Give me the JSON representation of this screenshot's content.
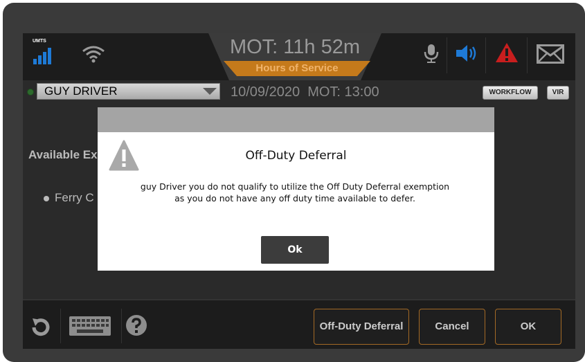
{
  "status_bar": {
    "network_label": "UMTS",
    "mot_timer": "MOT: 11h 52m",
    "hos_tab_label": "Hours of Service",
    "icons": [
      "signal-bars-icon",
      "wifi-icon",
      "microphone-icon",
      "speaker-icon",
      "warning-icon",
      "mail-icon"
    ],
    "colors": {
      "accent_orange": "#c57a1b",
      "speaker_blue": "#1e7ad6",
      "warning_red": "#c81e1e"
    }
  },
  "driver_row": {
    "driver_name": "GUY DRIVER",
    "date_mot": "10/09/2020  MOT: 13:00",
    "workflow_label": "WORKFLOW",
    "vir_label": "VIR"
  },
  "background_content": {
    "heading": "Available Ex",
    "list_item": "Ferry C"
  },
  "bottom_bar": {
    "icons": [
      "refresh-icon",
      "keyboard-icon",
      "help-icon"
    ],
    "off_duty_label": "Off-Duty Deferral",
    "cancel_label": "Cancel",
    "ok_label": "OK"
  },
  "modal": {
    "title": "Off-Duty Deferral",
    "message": "guy Driver  you do not qualify to utilize the Off Duty Deferral exemption as you do not have any off duty time available to defer.",
    "ok_label": "Ok",
    "icon": "warning-icon"
  }
}
